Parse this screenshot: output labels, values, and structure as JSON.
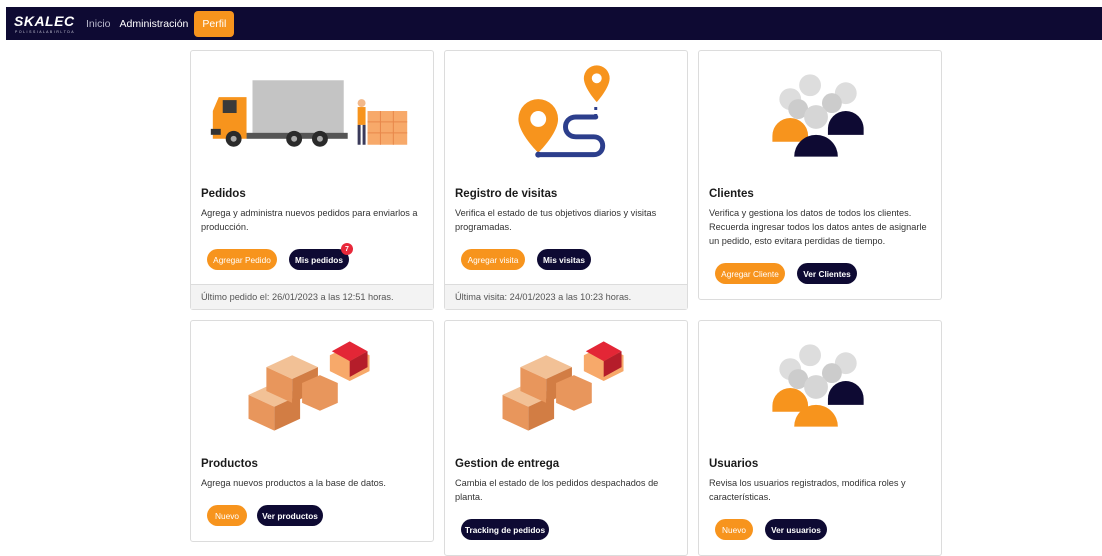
{
  "navbar": {
    "brand": "SKALEC",
    "brand_sub": "P O L I S S I A L A B I R  L T D A",
    "links": [
      "Inicio",
      "Administración",
      "Perfil"
    ]
  },
  "colors": {
    "accent": "#f7941d",
    "navy": "#0e0a33",
    "badge": "#e8283a"
  },
  "cards": {
    "pedidos": {
      "title": "Pedidos",
      "text": "Agrega y administra nuevos pedidos para enviarlos a producción.",
      "btn1": "Agregar Pedido",
      "btn2": "Mis pedidos",
      "badge": "7",
      "footer": "Último pedido el: 26/01/2023 a las 12:51 horas."
    },
    "visitas": {
      "title": "Registro de visitas",
      "text": "Verifica el estado de tus objetivos diarios y visitas programadas.",
      "btn1": "Agregar visita",
      "btn2": "Mis visitas",
      "footer": "Última visita: 24/01/2023 a las 10:23 horas."
    },
    "clientes": {
      "title": "Clientes",
      "text": "Verifica y gestiona los datos de todos los clientes. Recuerda ingresar todos los datos antes de asignarle un pedido, esto evitara perdidas de tiempo.",
      "btn1": "Agregar Cliente",
      "btn2": "Ver Clientes"
    },
    "productos": {
      "title": "Productos",
      "text": "Agrega nuevos productos a la base de datos.",
      "btn1": "Nuevo",
      "btn2": "Ver productos"
    },
    "entrega": {
      "title": "Gestion de entrega",
      "text": "Cambia el estado de los pedidos despachados de planta.",
      "btn1": "Tracking de pedidos"
    },
    "usuarios": {
      "title": "Usuarios",
      "text": "Revisa los usuarios registrados, modifica roles y características.",
      "btn1": "Nuevo",
      "btn2": "Ver usuarios"
    }
  }
}
